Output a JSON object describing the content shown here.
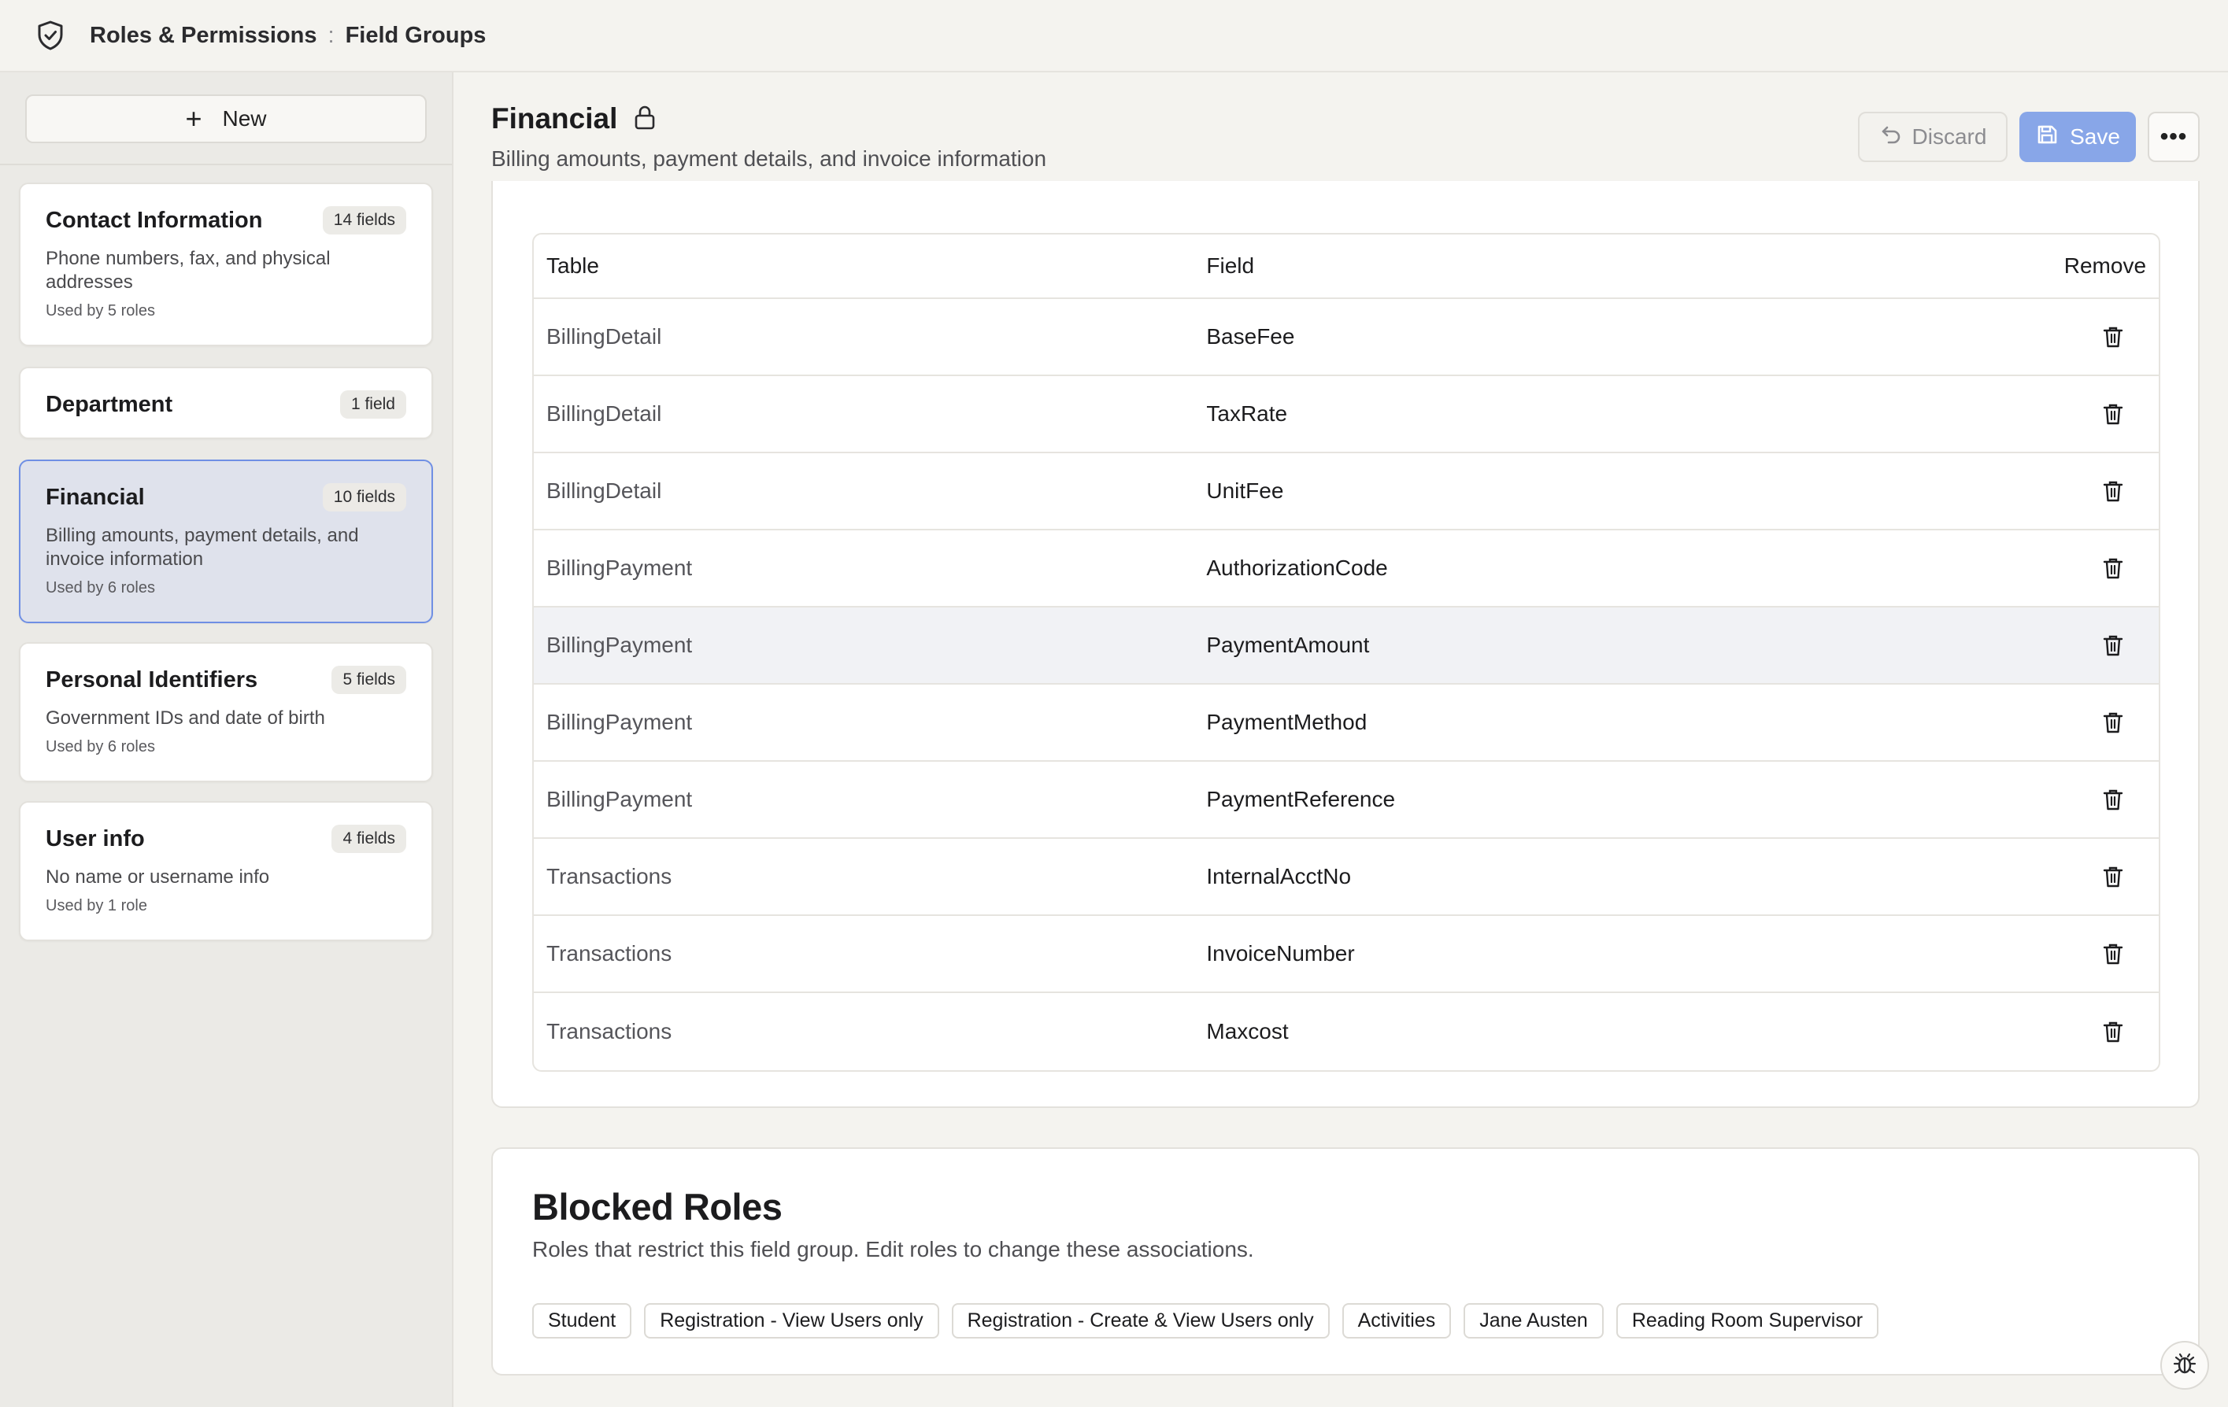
{
  "breadcrumb": {
    "root": "Roles & Permissions",
    "separator": ":",
    "current": "Field Groups"
  },
  "sidebar": {
    "new_label": "New",
    "groups": [
      {
        "title": "Contact Information",
        "badge": "14 fields",
        "description": "Phone numbers, fax, and physical addresses",
        "used_by": "Used by 5 roles",
        "selected": false
      },
      {
        "title": "Department",
        "badge": "1 field",
        "description": "",
        "used_by": "",
        "selected": false
      },
      {
        "title": "Financial",
        "badge": "10 fields",
        "description": "Billing amounts, payment details, and invoice information",
        "used_by": "Used by 6 roles",
        "selected": true
      },
      {
        "title": "Personal Identifiers",
        "badge": "5 fields",
        "description": "Government IDs and date of birth",
        "used_by": "Used by 6 roles",
        "selected": false
      },
      {
        "title": "User info",
        "badge": "4 fields",
        "description": "No name or username info",
        "used_by": "Used by 1 role",
        "selected": false
      }
    ]
  },
  "main": {
    "title": "Financial",
    "subtitle": "Billing amounts, payment details, and invoice information",
    "discard_label": "Discard",
    "save_label": "Save",
    "more_label": "•••"
  },
  "fields_table": {
    "headers": {
      "table": "Table",
      "field": "Field",
      "remove": "Remove"
    },
    "rows": [
      {
        "table": "BillingDetail",
        "field": "BaseFee"
      },
      {
        "table": "BillingDetail",
        "field": "TaxRate"
      },
      {
        "table": "BillingDetail",
        "field": "UnitFee"
      },
      {
        "table": "BillingPayment",
        "field": "AuthorizationCode"
      },
      {
        "table": "BillingPayment",
        "field": "PaymentAmount"
      },
      {
        "table": "BillingPayment",
        "field": "PaymentMethod"
      },
      {
        "table": "BillingPayment",
        "field": "PaymentReference"
      },
      {
        "table": "Transactions",
        "field": "InternalAcctNo"
      },
      {
        "table": "Transactions",
        "field": "InvoiceNumber"
      },
      {
        "table": "Transactions",
        "field": "Maxcost"
      }
    ]
  },
  "blocked_roles": {
    "title": "Blocked Roles",
    "subtitle": "Roles that restrict this field group. Edit roles to change these associations.",
    "roles": [
      "Student",
      "Registration - View Users only",
      "Registration - Create & View Users only",
      "Activities",
      "Jane Austen",
      "Reading Room Supervisor"
    ]
  },
  "colors": {
    "accent": "#88a6e8",
    "selected_border": "#6f8fe4",
    "selected_bg": "#dfe2ec"
  },
  "icons": {
    "header": "shield-check-icon",
    "title": "lock-icon",
    "discard": "undo-icon",
    "save": "floppy-disk-icon",
    "row_remove": "trash-icon",
    "debug": "bug-icon"
  }
}
